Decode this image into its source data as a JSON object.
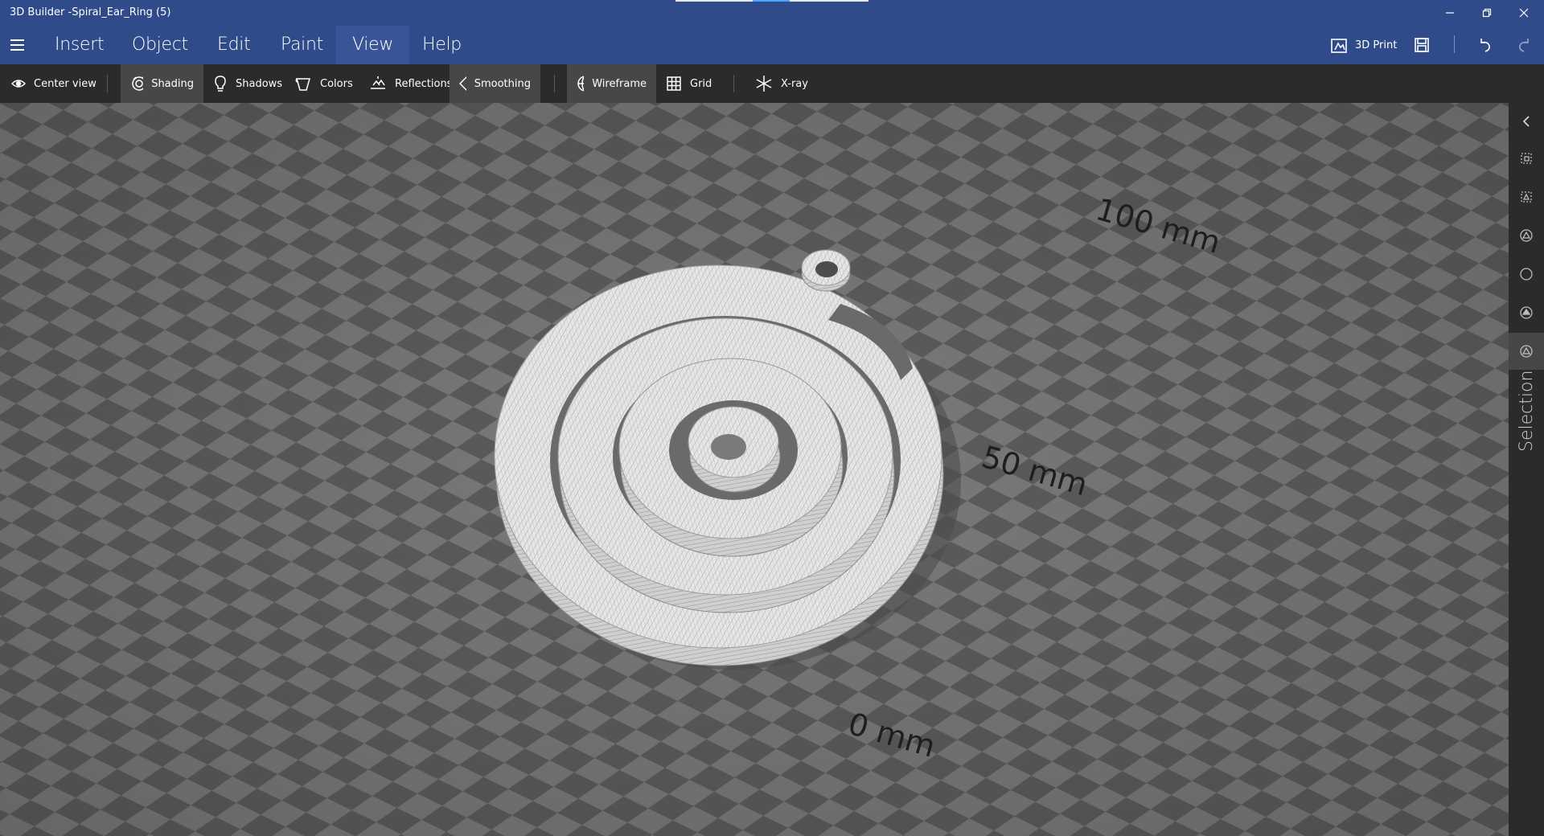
{
  "window": {
    "title": "3D Builder -Spiral_Ear_Ring (5)",
    "minimize_icon": "minimize-icon",
    "maximize_icon": "restore-icon",
    "close_icon": "close-icon"
  },
  "menu": {
    "items": [
      {
        "label": "Insert"
      },
      {
        "label": "Object"
      },
      {
        "label": "Edit"
      },
      {
        "label": "Paint"
      },
      {
        "label": "View",
        "active": true
      },
      {
        "label": "Help"
      }
    ],
    "print_label": "3D Print"
  },
  "toolbar": {
    "center_view": "Center view",
    "shading": "Shading",
    "shadows": "Shadows",
    "colors": "Colors",
    "reflections": "Reflections",
    "smoothing": "Smoothing",
    "wireframe": "Wireframe",
    "grid": "Grid",
    "xray": "X-ray"
  },
  "viewport": {
    "ruler_labels": [
      "100 mm",
      "50 mm",
      "0 mm"
    ]
  },
  "rightrail": {
    "label": "Selection"
  },
  "colors": {
    "titlebar": "#2f4b8a",
    "toolbar": "#2b2b2b",
    "checker_dark": "#5f5f5f",
    "checker_light": "#7d7d7d"
  }
}
